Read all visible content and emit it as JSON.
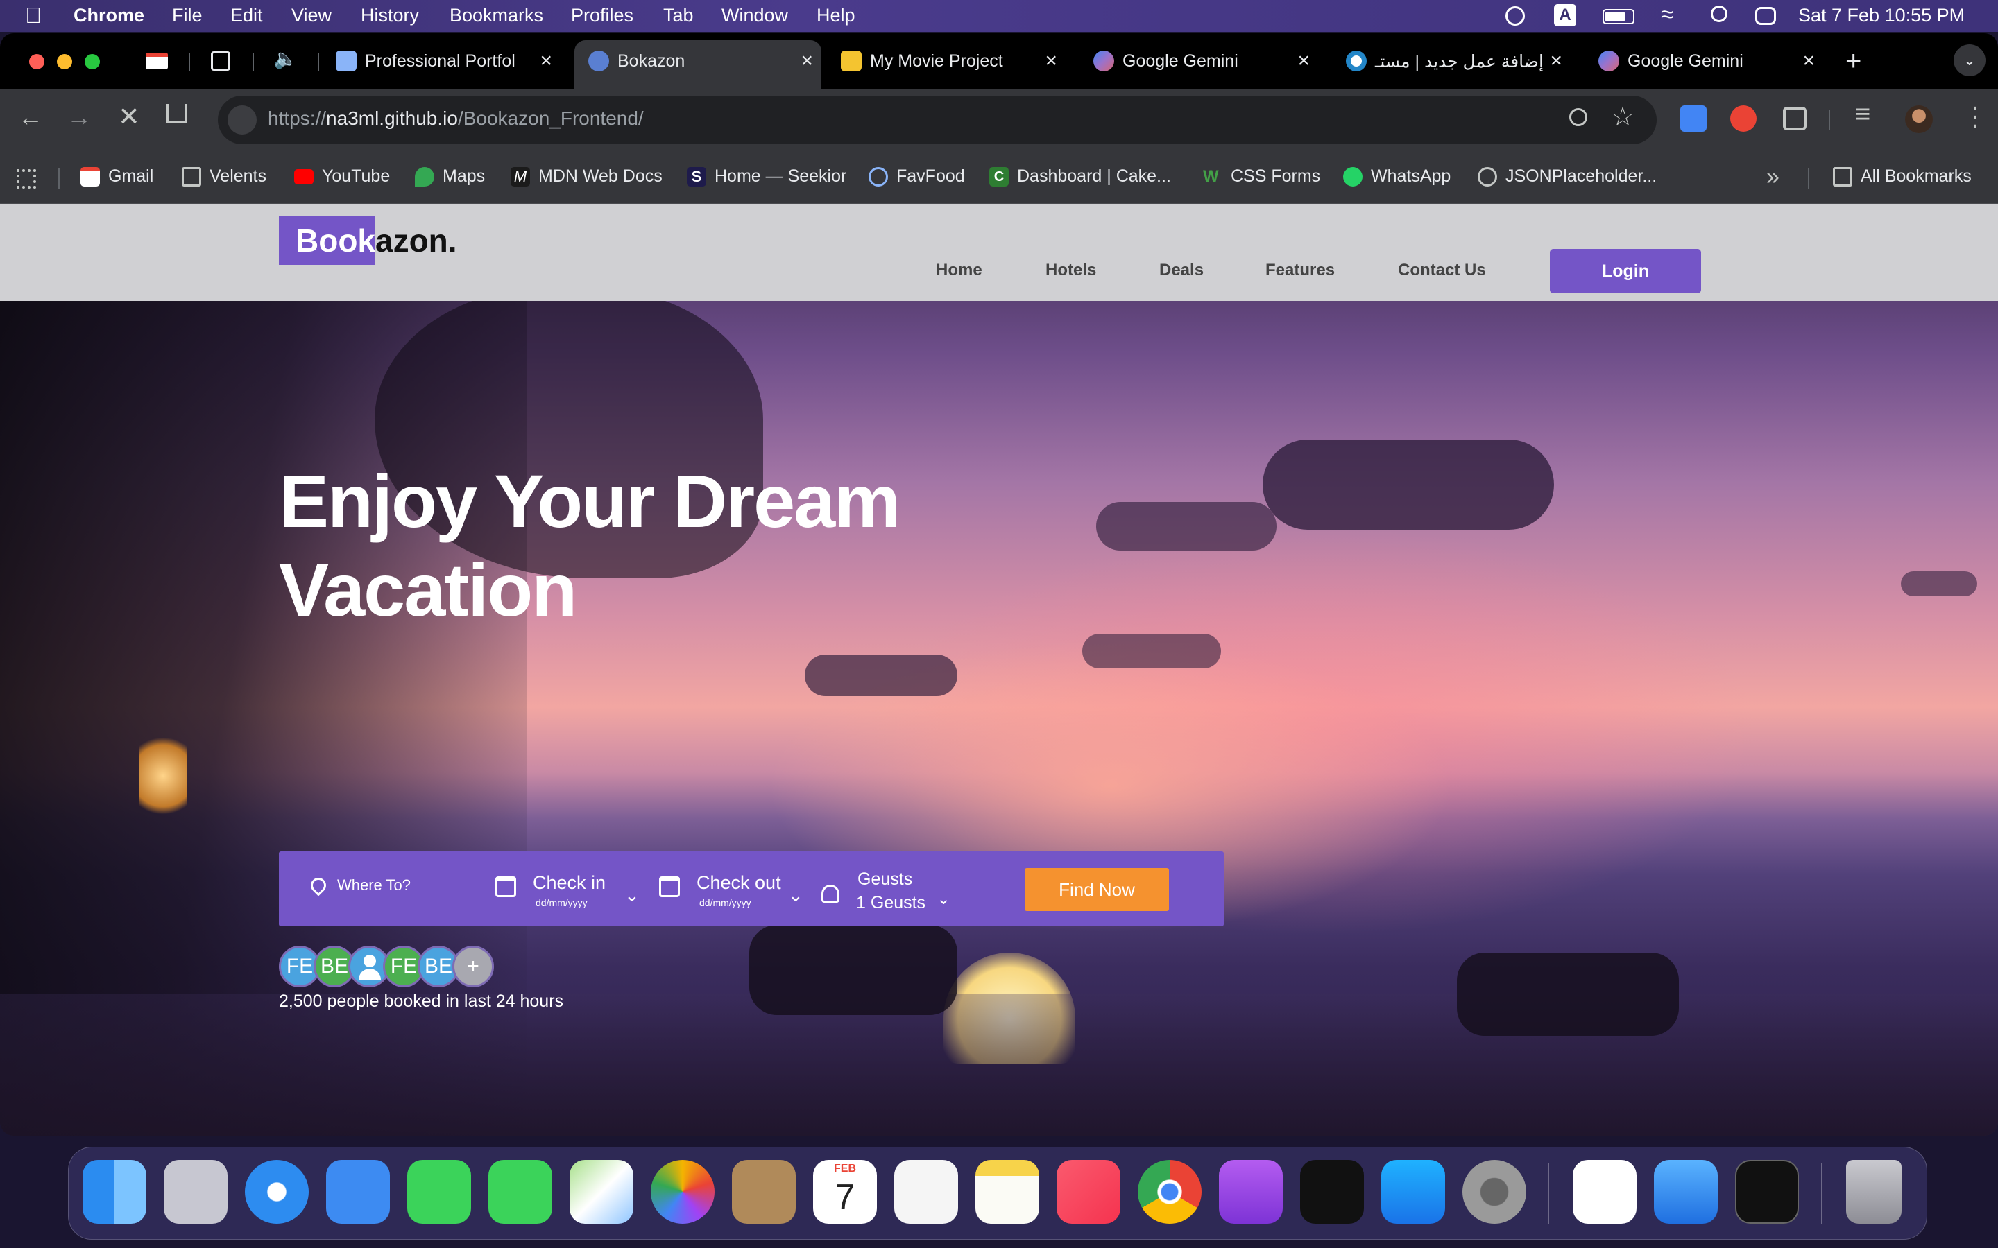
{
  "menubar": {
    "app": "Chrome",
    "items": [
      "File",
      "Edit",
      "View",
      "History",
      "Bookmarks",
      "Profiles",
      "Tab",
      "Window",
      "Help"
    ],
    "datetime": "Sat 7 Feb  10:55 PM",
    "input_indicator": "A"
  },
  "tabs": [
    {
      "title": "Professional Portfol",
      "active": false
    },
    {
      "title": "Bokazon",
      "active": true
    },
    {
      "title": "My Movie Project",
      "active": false
    },
    {
      "title": "Google Gemini",
      "active": false
    },
    {
      "title": "إضافة عمل جديد | مستـ",
      "active": false
    },
    {
      "title": "Google Gemini",
      "active": false
    }
  ],
  "tab_close": "×",
  "new_tab": "+",
  "address": {
    "scheme": "https://",
    "host": "na3ml.github.io",
    "path": "/Bookazon_Frontend/"
  },
  "bookmarks": [
    "Gmail",
    "Velents",
    "YouTube",
    "Maps",
    "MDN Web Docs",
    "Home — Seekior",
    "FavFood",
    "Dashboard | Cake...",
    "CSS Forms",
    "WhatsApp",
    "JSONPlaceholder...",
    "All Bookmarks"
  ],
  "site": {
    "logo_part1": "Book",
    "logo_part2": "azon",
    "logo_dot": ".",
    "nav": [
      "Home",
      "Hotels",
      "Deals",
      "Features",
      "Contact Us"
    ],
    "login_label": "Login",
    "hero_line1": "Enjoy Your Dream",
    "hero_line2": "Vacation",
    "search": {
      "where_label": "Where To?",
      "checkin_label": "Check in",
      "checkin_placeholder": "dd/mm/yyyy",
      "checkout_label": "Check out",
      "checkout_placeholder": "dd/mm/yyyy",
      "guests_label": "Geusts",
      "guests_value": "1 Geusts",
      "find_label": "Find Now"
    },
    "avatars": [
      "FE",
      "BE",
      "",
      "FE",
      "BE",
      "+"
    ],
    "booked_text": "2,500 people booked in last 24 hours"
  },
  "dock": {
    "calendar_month": "FEB",
    "calendar_day": "7",
    "apps": [
      "finder",
      "launchpad",
      "safari",
      "mail",
      "facetime",
      "messages",
      "maps",
      "photos",
      "contacts",
      "calendar",
      "reminders",
      "notes",
      "music",
      "chrome",
      "podcasts",
      "tv",
      "app-store",
      "system-settings",
      "vscode",
      "xcode",
      "terminal",
      "trash"
    ]
  },
  "colors": {
    "brand_purple": "#7455c7",
    "find_button": "#f5922f",
    "login_button": "#7455c7"
  }
}
